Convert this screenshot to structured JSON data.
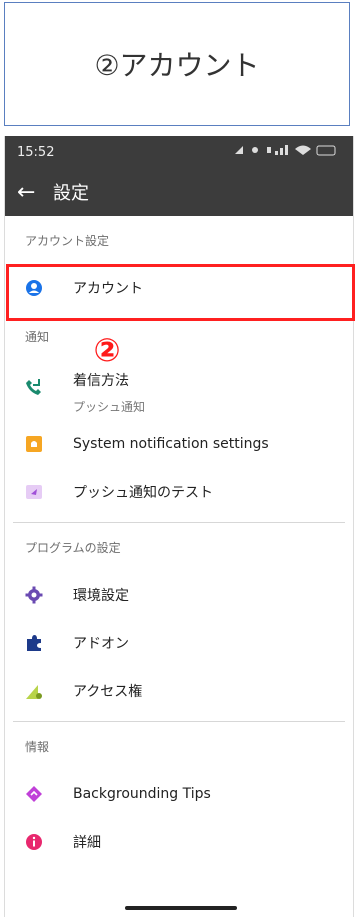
{
  "caption": "②アカウント",
  "status": {
    "time": "15:52",
    "battery": "40"
  },
  "appbar": {
    "title": "設定"
  },
  "sections": {
    "account": {
      "header": "アカウント設定",
      "items": [
        "アカウント"
      ]
    },
    "notify": {
      "header": "通知",
      "items": [
        {
          "label": "着信方法",
          "sub": "プッシュ通知"
        },
        {
          "label": "System notification settings"
        },
        {
          "label": "プッシュ通知のテスト"
        }
      ]
    },
    "program": {
      "header": "プログラムの設定",
      "items": [
        "環境設定",
        "アドオン",
        "アクセス権"
      ]
    },
    "info": {
      "header": "情報",
      "items": [
        "Backgrounding Tips",
        "詳細"
      ]
    }
  },
  "annotation": {
    "step": "②"
  },
  "colors": {
    "accent": "#1a73e8",
    "highlight": "#ff2020"
  }
}
